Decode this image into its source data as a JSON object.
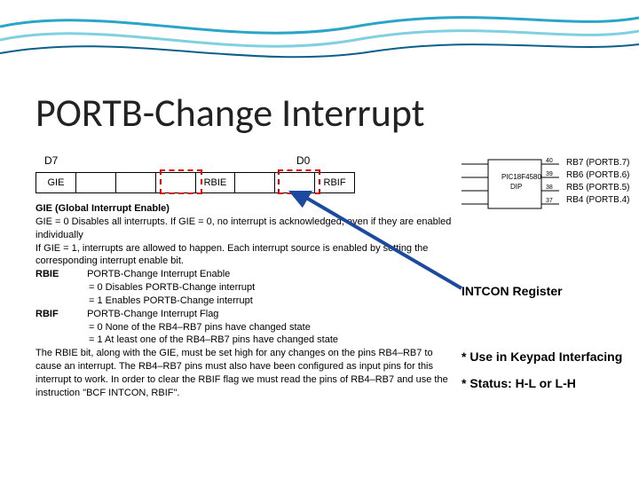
{
  "title": "PORTB-Change Interrupt",
  "bit_labels": {
    "msb": "D7",
    "lsb": "D0"
  },
  "register_cells": {
    "c0": "GIE",
    "c1": "",
    "c2": "",
    "c3": "",
    "c4": "RBIE",
    "c5": "",
    "c6": "",
    "c7": "RBIF"
  },
  "desc": {
    "gie_head": "GIE (Global Interrupt Enable)",
    "gie_line1": "GIE = 0   Disables all interrupts. If GIE = 0, no interrupt is acknowledged, even if they are enabled individually",
    "gie_line2": "If GIE = 1, interrupts are allowed to happen. Each interrupt source is enabled by setting the corresponding interrupt enable bit.",
    "rbie_lbl": "RBIE",
    "rbie_txt": "PORTB-Change Interrupt Enable",
    "rbie_0": "= 0 Disables PORTB-Change interrupt",
    "rbie_1": "= 1 Enables PORTB-Change interrupt",
    "rbif_lbl": "RBIF",
    "rbif_txt": "PORTB-Change Interrupt Flag",
    "rbif_0": "= 0 None of the RB4–RB7 pins have changed state",
    "rbif_1": "= 1 At least one of the RB4–RB7 pins have changed state",
    "tail": "The RBIE bit, along with the GIE, must be set high for any changes on the pins RB4–RB7 to cause an interrupt. The RB4–RB7 pins must also have been configured as input pins for this interrupt to work. In order to clear the RBIF flag we must read the pins of RB4–RB7 and use the instruction \"BCF INTCON, RBIF\"."
  },
  "side_pins": {
    "p7": "RB7 (PORTB.7)",
    "p6": "RB6 (PORTB.6)",
    "p5": "RB5 (PORTB.5)",
    "p4": "RB4 (PORTB.4)",
    "chip": "PIC18F4580\n      DIP"
  },
  "side_notes": {
    "reg": "INTCON Register",
    "use": "* Use in Keypad Interfacing",
    "status": "* Status: H-L or L-H"
  }
}
